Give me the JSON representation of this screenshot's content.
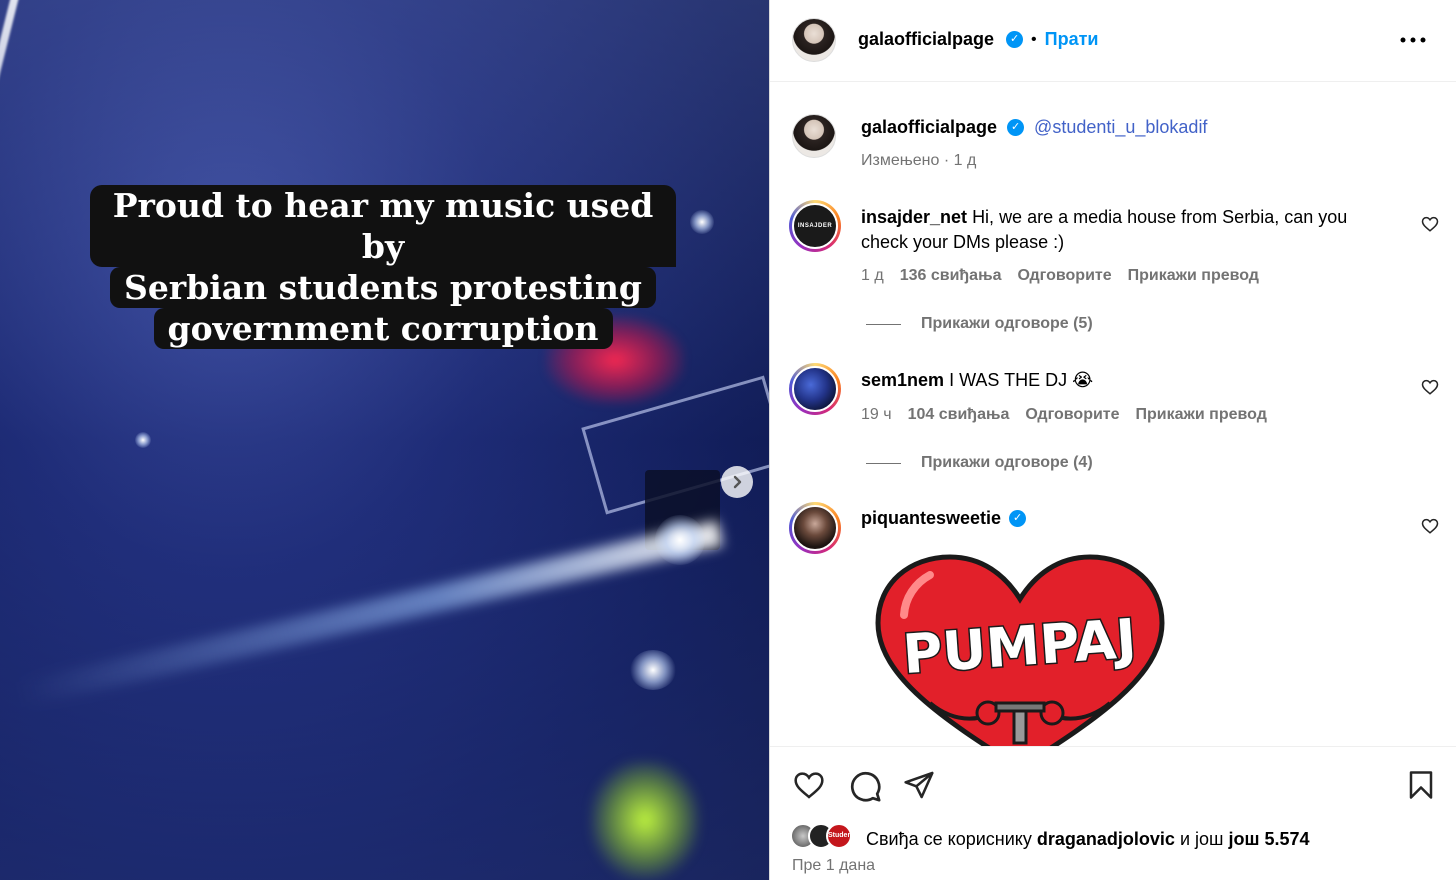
{
  "post": {
    "caption_lines": [
      "Proud to hear my music used by",
      "Serbian students protesting",
      "government corruption"
    ]
  },
  "header": {
    "username": "galaofficialpage",
    "dot": "•",
    "follow_label": "Прати",
    "more_icon": "more-horizontal-icon"
  },
  "owner_comment": {
    "username": "galaofficialpage",
    "mention": "@studenti_u_blokadif",
    "edited": "Измењено",
    "dot": "·",
    "time": "1 д"
  },
  "comments": [
    {
      "username": "insajder_net",
      "avatar_text": "INSAJDER",
      "text": "Hi, we are a media house from Serbia, can you check your DMs please :)",
      "time": "1 д",
      "likes": "136 свиђања",
      "reply_label": "Одговорите",
      "translate_label": "Прикажи превод",
      "view_replies": "Прикажи одговоре (5)"
    },
    {
      "username": "sem1nem",
      "text": "I WAS THE DJ",
      "emoji": "😭",
      "time": "19 ч",
      "likes": "104 свиђања",
      "reply_label": "Одговорите",
      "translate_label": "Прикажи превод",
      "view_replies": "Прикажи одговоре (4)"
    },
    {
      "username": "piquantesweetie",
      "sticker_text": "PUMPAJ"
    }
  ],
  "footer": {
    "liked_prefix": "Свиђа се кориснику",
    "liked_user": "draganadjolovic",
    "liked_and": "и још",
    "liked_count": "још 5.574",
    "avatar_badge": "Student",
    "posted": "Пре 1 дана"
  },
  "colors": {
    "accent": "#0095f6",
    "link": "#4262c8",
    "muted": "#737373",
    "sticker_red": "#e2202a"
  }
}
